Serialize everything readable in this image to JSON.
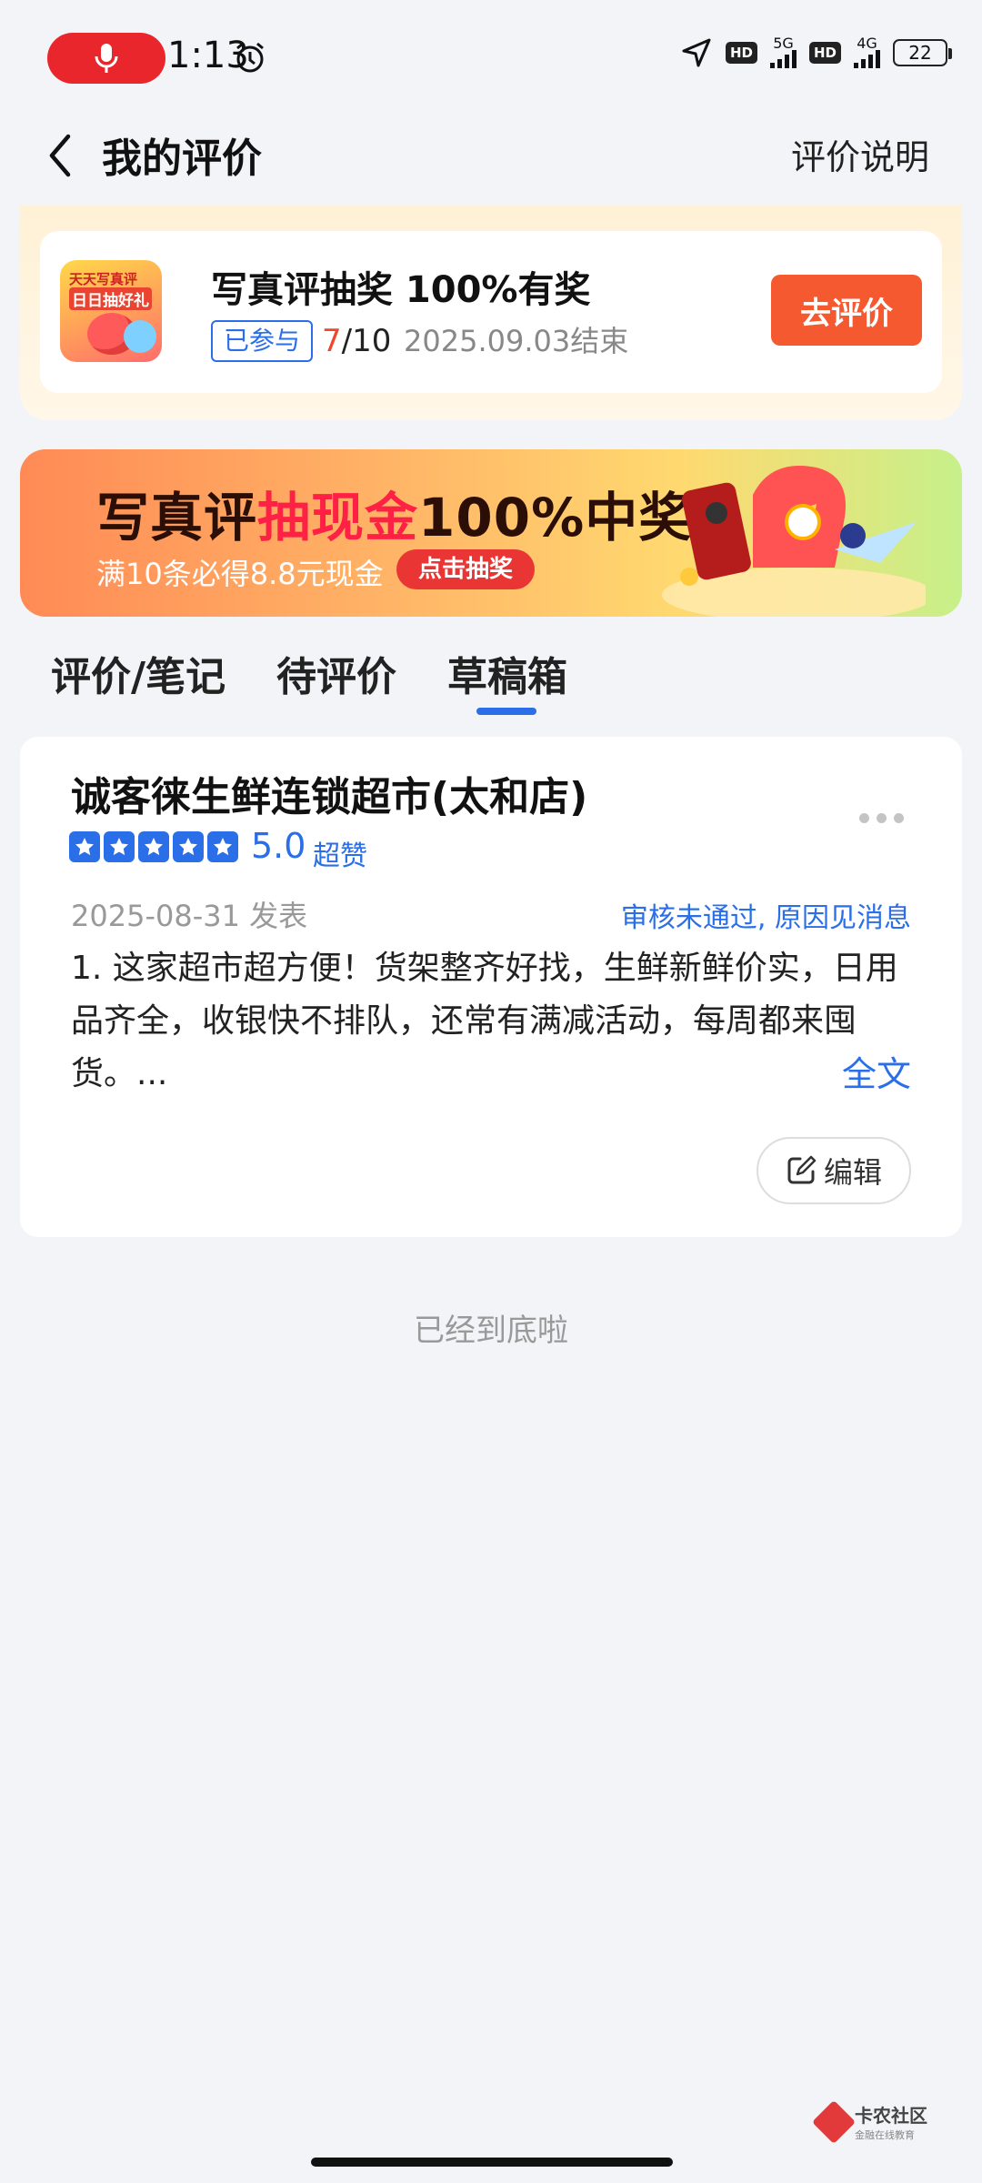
{
  "status_bar": {
    "time": "1:13",
    "net1": "5G",
    "net2": "4G",
    "hd": "HD",
    "battery": "22"
  },
  "header": {
    "title": "我的评价",
    "rules_link": "评价说明"
  },
  "campaign": {
    "thumb_line1": "天天写真评",
    "thumb_line2": "日日抽好礼",
    "title": "写真评抽奖 100%有奖",
    "joined_label": "已参与",
    "progress_done": "7",
    "progress_total": "/10",
    "end_date": "2025.09.03结束",
    "cta": "去评价"
  },
  "banner": {
    "title_part1": "写真评",
    "title_highlight": "抽现金",
    "title_part2": "100%中奖",
    "subtitle": "满10条必得8.8元现金",
    "button": "点击抽奖"
  },
  "tabs": [
    {
      "label": "评价/笔记",
      "active": false
    },
    {
      "label": "待评价",
      "active": false
    },
    {
      "label": "草稿箱",
      "active": true
    }
  ],
  "review": {
    "store": "诚客徕生鲜连锁超市(太和店)",
    "stars": 5,
    "score": "5.0",
    "score_label": "超赞",
    "date": "2025-08-31 发表",
    "status": "审核未通过, 原因见消息",
    "text": "1. 这家超市超方便！货架整齐好找，生鲜新鲜价实，日用品齐全，收银快不排队，还常有满减活动，每周都来囤货。...",
    "full_link": "全文",
    "edit_label": "编辑"
  },
  "end_hint": "已经到底啦",
  "watermark": {
    "name": "卡农社区",
    "sub": "金融在线教育"
  },
  "colors": {
    "accent": "#2a6ee8",
    "cta": "#f5592f",
    "record": "#e8262b"
  }
}
